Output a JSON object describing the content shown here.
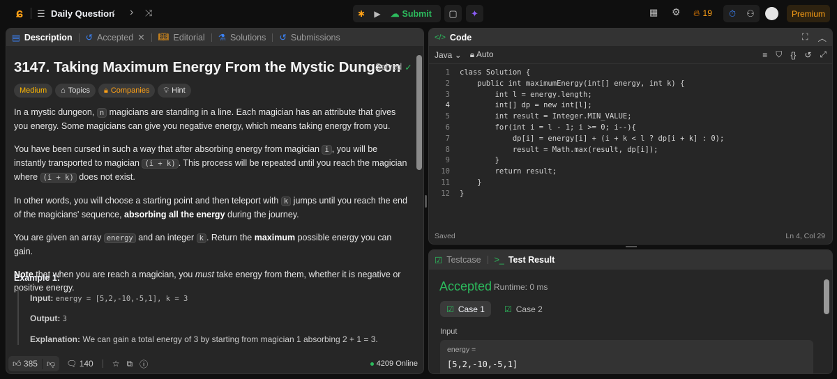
{
  "nav": {
    "title": "Daily Question",
    "submit": "Submit",
    "streak": "19",
    "premium": "Premium"
  },
  "left": {
    "tabs": [
      "Description",
      "Accepted",
      "Editorial",
      "Solutions",
      "Submissions"
    ],
    "title": "3147. Taking Maximum Energy From the Mystic Dungeon",
    "solved": "Solved",
    "tags": {
      "difficulty": "Medium",
      "topics": "Topics",
      "companies": "Companies",
      "hint": "Hint"
    },
    "paragraphs": [
      [
        {
          "s": "text",
          "t": "In a mystic dungeon, "
        },
        {
          "s": "code",
          "t": "n"
        },
        {
          "s": "text",
          "t": " magicians are standing in a line. Each magician has an attribute that gives you energy. Some magicians can give you negative energy, which means taking energy from you."
        }
      ],
      [
        {
          "s": "text",
          "t": "You have been cursed in such a way that after absorbing energy from magician "
        },
        {
          "s": "code",
          "t": "i"
        },
        {
          "s": "text",
          "t": ", you will be instantly transported to magician "
        },
        {
          "s": "code",
          "t": "(i + k)"
        },
        {
          "s": "text",
          "t": ". This process will be repeated until you reach the magician where "
        },
        {
          "s": "code",
          "t": "(i + k)"
        },
        {
          "s": "text",
          "t": " does not exist."
        }
      ],
      [
        {
          "s": "text",
          "t": "In other words, you will choose a starting point and then teleport with "
        },
        {
          "s": "code",
          "t": "k"
        },
        {
          "s": "text",
          "t": " jumps until you reach the end of the magicians' sequence, "
        },
        {
          "s": "bold",
          "t": "absorbing all the energy"
        },
        {
          "s": "text",
          "t": " during the journey."
        }
      ],
      [
        {
          "s": "text",
          "t": "You are given an array "
        },
        {
          "s": "code",
          "t": "energy"
        },
        {
          "s": "text",
          "t": " and an integer "
        },
        {
          "s": "code",
          "t": "k"
        },
        {
          "s": "text",
          "t": ". Return the "
        },
        {
          "s": "bold",
          "t": "maximum"
        },
        {
          "s": "text",
          "t": " possible energy you can gain."
        }
      ],
      [
        {
          "s": "bold",
          "t": "Note"
        },
        {
          "s": "text",
          "t": " that when you are reach a magician, you "
        },
        {
          "s": "italic",
          "t": "must"
        },
        {
          "s": "text",
          "t": " take energy from them, whether it is negative or positive energy."
        }
      ]
    ],
    "example": {
      "title": "Example 1:",
      "input_label": "Input:",
      "input": "energy = [5,2,-10,-5,1], k = 3",
      "output_label": "Output:",
      "output": "3",
      "expl_label": "Explanation:",
      "expl": "We can gain a total energy of 3 by starting from magician 1 absorbing 2 + 1 = 3."
    },
    "footer": {
      "likes": "385",
      "comments": "140",
      "online": "4209 Online"
    }
  },
  "code": {
    "title": "Code",
    "language": "Java",
    "mode": "Auto",
    "lines": [
      "class Solution {",
      "    public int maximumEnergy(int[] energy, int k) {",
      "        int l = energy.length;",
      "        int[] dp = new int[l];",
      "        int result = Integer.MIN_VALUE;",
      "        for(int i = l - 1; i >= 0; i--){",
      "            dp[i] = energy[i] + (i + k < l ? dp[i + k] : 0);",
      "            result = Math.max(result, dp[i]);",
      "        }",
      "        return result;",
      "    }",
      "}"
    ],
    "status": "Saved",
    "cursor": "Ln 4, Col 29"
  },
  "test": {
    "tabs": [
      "Testcase",
      "Test Result"
    ],
    "verdict": "Accepted",
    "runtime": "Runtime: 0 ms",
    "cases": [
      "Case 1",
      "Case 2"
    ],
    "input_label": "Input",
    "var": "energy =",
    "value": "[5,2,-10,-5,1]"
  },
  "colors": {
    "accent": "#2cbb5d",
    "medium": "#ffb800",
    "orange": "#ffa116"
  }
}
